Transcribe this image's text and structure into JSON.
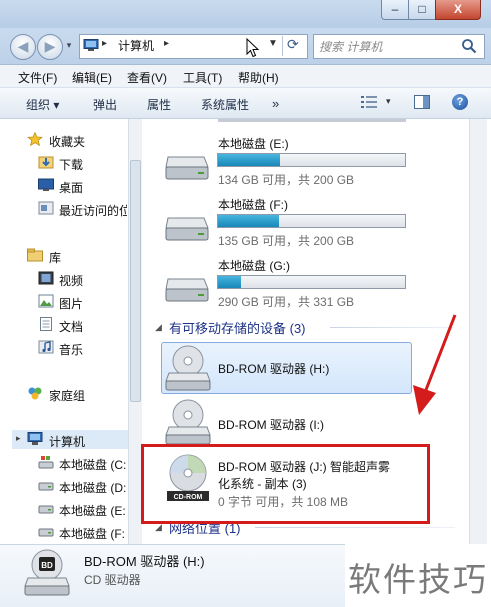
{
  "window": {
    "min_label": "–",
    "max_label": "□",
    "close_label": "X"
  },
  "address": {
    "path": "计算机",
    "separator": "▸",
    "search_placeholder": "搜索 计算机",
    "refresh_glyph": "⟳"
  },
  "nav_buttons": {
    "back": "◀",
    "forward": "▶",
    "history": "▾"
  },
  "menu": [
    "文件(F)",
    "编辑(E)",
    "查看(V)",
    "工具(T)",
    "帮助(H)"
  ],
  "toolbar": {
    "organize": "组织 ▾",
    "eject": "弹出",
    "properties": "属性",
    "system_properties": "系统属性",
    "more": "»",
    "view_dd": "▾",
    "help": "?"
  },
  "sidebar": {
    "favorites": {
      "title": "收藏夹",
      "items": [
        "下载",
        "桌面",
        "最近访问的位"
      ]
    },
    "libraries": {
      "title": "库",
      "items": [
        "视频",
        "图片",
        "文档",
        "音乐"
      ]
    },
    "homegroup": "家庭组",
    "computer": {
      "title": "计算机",
      "items": [
        "本地磁盘 (C:",
        "本地磁盘 (D:",
        "本地磁盘 (E:",
        "本地磁盘 (F:"
      ]
    }
  },
  "drives": [
    {
      "name": "本地磁盘 (E:)",
      "free": "134 GB 可用，共 200 GB",
      "used_fraction": 0.33
    },
    {
      "name": "本地磁盘 (F:)",
      "free": "135 GB 可用，共 200 GB",
      "used_fraction": 0.325
    },
    {
      "name": "本地磁盘 (G:)",
      "free": "290 GB 可用，共 331 GB",
      "used_fraction": 0.124
    }
  ],
  "removable_group": "有可移动存储的设备 (3)",
  "removable": [
    {
      "name": "BD-ROM 驱动器 (H:)"
    },
    {
      "name": "BD-ROM 驱动器 (I:)"
    },
    {
      "name_line1": "BD-ROM 驱动器 (J:) 智能超声雾",
      "name_line2": "化系统 - 副本 (3)",
      "free": "0 字节 可用，共 108 MB",
      "disc_label": "CD-ROM"
    }
  ],
  "network_group": "网络位置 (1)",
  "details": {
    "name": "BD-ROM 驱动器 (H:)",
    "type": "CD 驱动器",
    "disc_label": "BD"
  },
  "watermark": "软件技巧",
  "colors": {
    "annotation": "#d41c1c",
    "usage_bar": "#1987b8",
    "selection": "#d3e6fb"
  }
}
